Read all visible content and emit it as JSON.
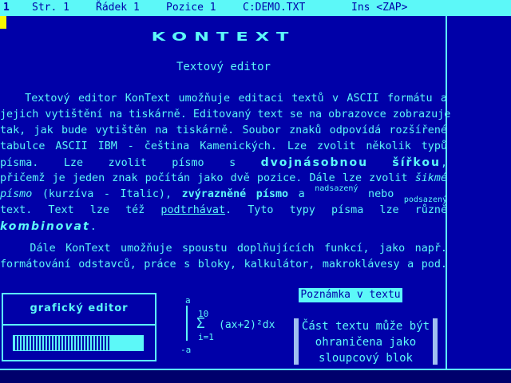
{
  "status": {
    "line_number": "1",
    "page": "Str. 1",
    "row": "Řádek 1",
    "column": "Pozice 1",
    "file": "C:DEMO.TXT",
    "mode": "Ins <ZAP>"
  },
  "document": {
    "title": "KONTEXT",
    "subtitle": "Textový editor",
    "p1": {
      "l1": "   Textový editor KonText umožňuje editaci textů v ASCII formátu a",
      "l2": "jejich vytištění na tiskárně. Editovaný text se na obrazovce zobrazuje",
      "l3": "tak, jak bude vytištěn na tiskárně. Soubor znaků odpovídá rozšířené",
      "l4": "tabulce ASCII IBM - čeština Kamenických. Lze zvolit několik typů",
      "l5_a": "písma. Lze zvolit písmo s",
      "l5_b": "dvojnásobnou šířkou",
      "l5_c": ",",
      "l6_a": "přičemž je jeden znak počítán jako dvě pozice. Dále lze zvolit",
      "l6_b": "šikmé",
      "l7_a": "písmo",
      "l7_b": " (kurzíva - Italic),",
      "l7_c": "zvýrazněné písmo",
      "l7_d": "a",
      "l7_e": "nadsazený",
      "l7_f": "nebo",
      "l7_g": "podsazený",
      "l8_a": "text. Text lze též",
      "l8_b": "podtrhávat",
      "l8_c": ". Tyto typy písma lze různě",
      "l9_a": "kombinovat",
      "l9_b": "."
    },
    "p2": {
      "l1": "   Dále KonText umožňuje spoustu doplňujících funkcí, jako např.",
      "l2": "formátování odstavců, práce s bloky, kalkulátor, makroklávesy a pod."
    }
  },
  "graphic_editor": {
    "label": "grafický editor",
    "fill_fraction": 0.74
  },
  "formula": {
    "upper_limit": "a",
    "lower_limit": "-a",
    "sum_upper": "10",
    "sum_symbol": "Σ",
    "expression": "(ax+2)²dx",
    "sum_lower": "i=1"
  },
  "note": {
    "title": "Poznámka v textu",
    "lines": [
      "Část textu může být",
      "ohraničena jako",
      "sloupcový blok"
    ]
  }
}
